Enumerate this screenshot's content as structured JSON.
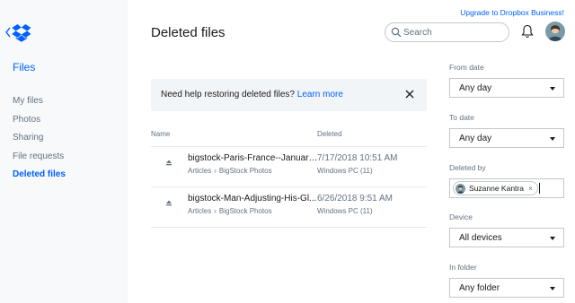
{
  "upgrade_link": "Upgrade to Dropbox Business!",
  "sidebar": {
    "heading": "Files",
    "items": [
      {
        "label": "My files"
      },
      {
        "label": "Photos"
      },
      {
        "label": "Sharing"
      },
      {
        "label": "File requests"
      },
      {
        "label": "Deleted files",
        "active": true
      }
    ]
  },
  "header": {
    "title": "Deleted files",
    "search_placeholder": "Search"
  },
  "banner": {
    "text": "Need help restoring deleted files?",
    "link": "Learn more"
  },
  "table": {
    "columns": {
      "name": "Name",
      "deleted": "Deleted"
    },
    "rows": [
      {
        "name": "bigstock-Paris-France--January-...",
        "path": [
          "Articles",
          "BigStock Photos"
        ],
        "deleted": "7/17/2018 10:51 AM",
        "device": "Windows PC (11)"
      },
      {
        "name": "bigstock-Man-Adjusting-His-Gl...",
        "path": [
          "Articles",
          "BigStock Photos"
        ],
        "deleted": "6/26/2018 9:51 AM",
        "device": "Windows PC (11)"
      }
    ],
    "path_separator": "›"
  },
  "filters": {
    "from_date": {
      "label": "From date",
      "value": "Any day"
    },
    "to_date": {
      "label": "To date",
      "value": "Any day"
    },
    "deleted_by": {
      "label": "Deleted by",
      "token": "Suzanne Kantra",
      "remove": "×"
    },
    "device": {
      "label": "Device",
      "value": "All devices"
    },
    "in_folder": {
      "label": "In folder",
      "value": "Any folder"
    }
  },
  "colors": {
    "accent": "#0061fe",
    "sidebar_bg": "#f7f9fa",
    "muted_text": "#637282",
    "banner_bg": "#f2f5f7"
  },
  "icons": {
    "back": "chevron-left-icon",
    "logo": "dropbox-logo",
    "search": "search-icon",
    "notifications": "bell-icon",
    "close": "close-icon",
    "file": "deleted-file-icon"
  }
}
